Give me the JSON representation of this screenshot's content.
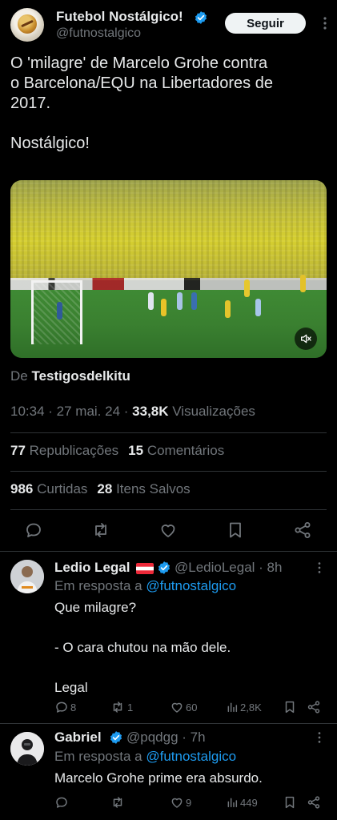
{
  "post": {
    "author_name": "Futebol Nostálgico!",
    "author_handle": "@futnostalgico",
    "follow_label": "Seguir",
    "text": "O 'milagre' de Marcelo Grohe contra\no Barcelona/EQU na Libertadores de\n2017.\n\nNostálgico!",
    "source_prefix": "De",
    "source_name": "Testigosdelkitu",
    "time": "10:34 · 27 mai. 24 ·",
    "views_count": "33,8K",
    "views_label": "Visualizações",
    "reposts_count": "77",
    "reposts_label": "Republicações",
    "comments_count": "15",
    "comments_label": "Comentários",
    "likes_count": "986",
    "likes_label": "Curtidas",
    "saves_count": "28",
    "saves_label": "Itens Salvos"
  },
  "icons": {
    "verified": "verified-badge-icon",
    "more": "more-vertical-icon",
    "mute": "speaker-muted-icon",
    "reply": "reply-icon",
    "repost": "repost-icon",
    "like": "heart-icon",
    "bookmark": "bookmark-icon",
    "share": "share-icon",
    "views": "views-chart-icon"
  },
  "colors": {
    "accent": "#1d9bf0",
    "muted": "#71767b",
    "text": "#e7e9ea",
    "background": "#000000"
  },
  "replies": [
    {
      "name": "Ledio Legal",
      "flag": "🇦🇹",
      "handle": "@LedioLegal · 8h",
      "in_reply_prefix": "Em resposta a",
      "in_reply_to": "@futnostalgico",
      "text": "Que milagre?\n\n- O cara chutou na mão dele.\n\nLegal",
      "replies": "8",
      "reposts": "1",
      "likes": "60",
      "views": "2,8K"
    },
    {
      "name": "Gabriel",
      "handle": "@pqdgg · 7h",
      "in_reply_prefix": "Em resposta a",
      "in_reply_to": "@futnostalgico",
      "text": "Marcelo Grohe prime era absurdo.",
      "replies": "",
      "reposts": "",
      "likes": "9",
      "views": "449"
    }
  ]
}
